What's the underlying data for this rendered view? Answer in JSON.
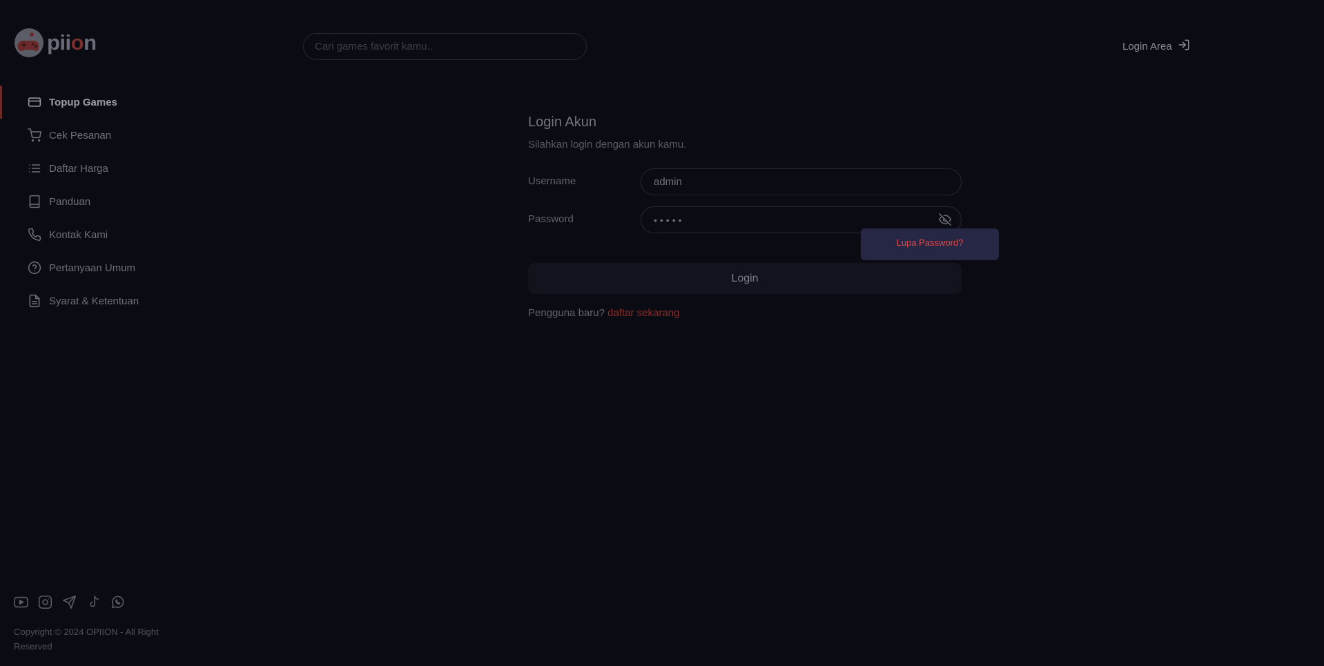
{
  "brand": {
    "name_main": "pii",
    "name_accent": "o",
    "name_end": "n",
    "logo_icon": "gamepad-logo-icon"
  },
  "header": {
    "search_placeholder": "Cari games favorit kamu..",
    "login_area_label": "Login Area",
    "login_area_icon": "sign-in-icon"
  },
  "sidebar": {
    "items": [
      {
        "label": "Topup Games",
        "icon": "credit-card-icon",
        "active": true
      },
      {
        "label": "Cek Pesanan",
        "icon": "cart-icon",
        "active": false
      },
      {
        "label": "Daftar Harga",
        "icon": "list-icon",
        "active": false
      },
      {
        "label": "Panduan",
        "icon": "book-icon",
        "active": false
      },
      {
        "label": "Kontak Kami",
        "icon": "phone-icon",
        "active": false
      },
      {
        "label": "Pertanyaan Umum",
        "icon": "question-icon",
        "active": false
      },
      {
        "label": "Syarat & Ketentuan",
        "icon": "document-icon",
        "active": false
      }
    ],
    "socials": [
      "youtube-icon",
      "instagram-icon",
      "telegram-icon",
      "tiktok-icon",
      "whatsapp-icon"
    ],
    "copyright": "Copyright © 2024 OPIION - All Right Reserved"
  },
  "login": {
    "title": "Login Akun",
    "subtitle": "Silahkan login dengan akun kamu.",
    "username_label": "Username",
    "username_value": "admin",
    "password_label": "Password",
    "password_value": "•••••",
    "forgot_label": "Lupa Password?",
    "submit_label": "Login",
    "register_prompt": "Pengguna baru?",
    "register_link": "daftar sekarang"
  },
  "colors": {
    "background": "#0b0b13",
    "accent_red": "#e04848",
    "popover_bg": "#262744"
  }
}
